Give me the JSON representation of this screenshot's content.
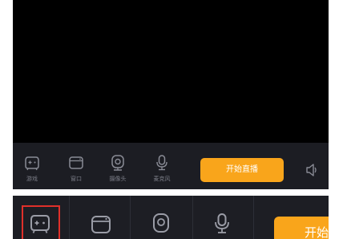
{
  "colors": {
    "preview_bg": "#000000",
    "toolbar_bg": "#1c1d23",
    "icon_color": "#8a8c96",
    "label_color": "#7d7f89",
    "accent_orange": "#f9a51b",
    "highlight_red": "#e0302a"
  },
  "toolbar": {
    "items": [
      {
        "label": "游戏",
        "icon": "gamepad-icon"
      },
      {
        "label": "窗口",
        "icon": "window-icon"
      },
      {
        "label": "摄像头",
        "icon": "camera-icon"
      },
      {
        "label": "麦克风",
        "icon": "microphone-icon"
      }
    ],
    "start_label": "开始直播",
    "volume_icon": "speaker-icon"
  },
  "zoomed": {
    "highlighted_icon": "gamepad-icon",
    "start_label_partial": "开始"
  }
}
